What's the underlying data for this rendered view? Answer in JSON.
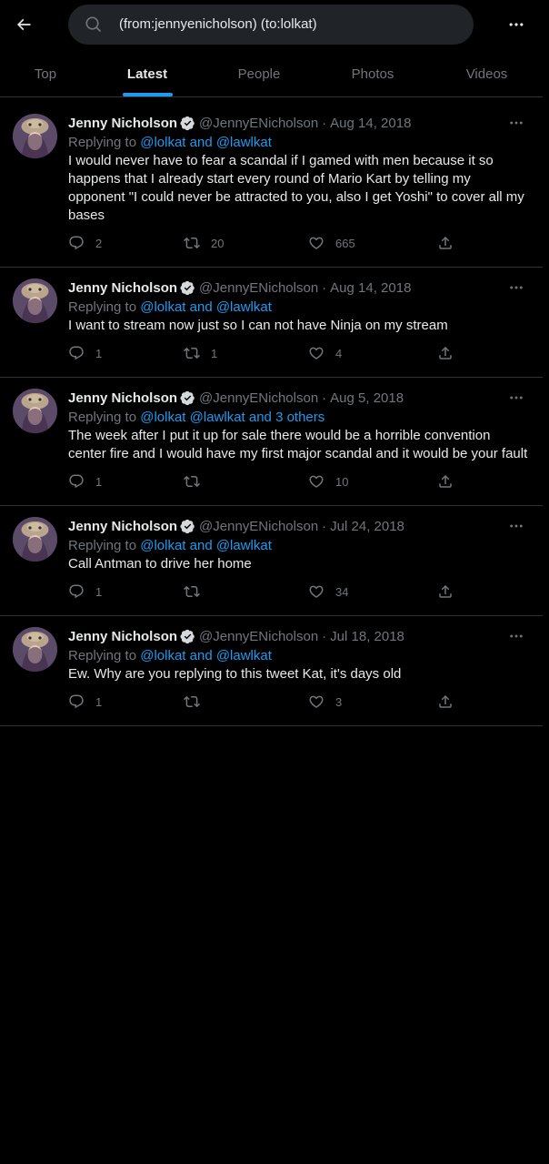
{
  "search": {
    "query": "(from:jennyenicholson) (to:lolkat)"
  },
  "tabs": [
    {
      "label": "Top"
    },
    {
      "label": "Latest"
    },
    {
      "label": "People"
    },
    {
      "label": "Photos"
    },
    {
      "label": "Videos"
    }
  ],
  "tweets": [
    {
      "name": "Jenny Nicholson",
      "handle": "@JennyENicholson",
      "date": "Aug 14, 2018",
      "replying_prefix": "Replying to ",
      "replying_mentions": "@lolkat and @lawlkat",
      "text": "I would never have to fear a scandal if I gamed with men because it so happens that I already start every round of Mario Kart by telling my opponent \"I could never be attracted to you, also I get Yoshi\" to cover all my bases",
      "replies": "2",
      "retweets": "20",
      "likes": "665"
    },
    {
      "name": "Jenny Nicholson",
      "handle": "@JennyENicholson",
      "date": "Aug 14, 2018",
      "replying_prefix": "Replying to ",
      "replying_mentions": "@lolkat and @lawlkat",
      "text": "I want to stream now just so I can not have Ninja on my stream",
      "replies": "1",
      "retweets": "1",
      "likes": "4"
    },
    {
      "name": "Jenny Nicholson",
      "handle": "@JennyENicholson",
      "date": "Aug 5, 2018",
      "replying_prefix": "Replying to ",
      "replying_mentions": "@lolkat @lawlkat and 3 others",
      "text": "The week after I put it up for sale there would be a horrible convention center fire and I would have my first major scandal and it would be your fault",
      "replies": "1",
      "retweets": "",
      "likes": "10"
    },
    {
      "name": "Jenny Nicholson",
      "handle": "@JennyENicholson",
      "date": "Jul 24, 2018",
      "replying_prefix": "Replying to ",
      "replying_mentions": "@lolkat and @lawlkat",
      "text": "Call Antman to drive her home",
      "replies": "1",
      "retweets": "",
      "likes": "34"
    },
    {
      "name": "Jenny Nicholson",
      "handle": "@JennyENicholson",
      "date": "Jul 18, 2018",
      "replying_prefix": "Replying to ",
      "replying_mentions": "@lolkat and @lawlkat",
      "text": "Ew. Why are you replying to this tweet Kat, it's days old",
      "replies": "1",
      "retweets": "",
      "likes": "3"
    }
  ],
  "dot_separator": "·",
  "icons": {
    "back": "arrow-left-icon",
    "search": "search-icon",
    "more": "more-horizontal-icon",
    "verified": "verified-badge-icon",
    "reply": "reply-icon",
    "retweet": "retweet-icon",
    "like": "heart-icon",
    "share": "share-icon"
  },
  "colors": {
    "accent": "#1d9bf0",
    "muted": "#71767b",
    "text": "#e7e9ea",
    "background": "#000000",
    "border": "#2f3336"
  }
}
